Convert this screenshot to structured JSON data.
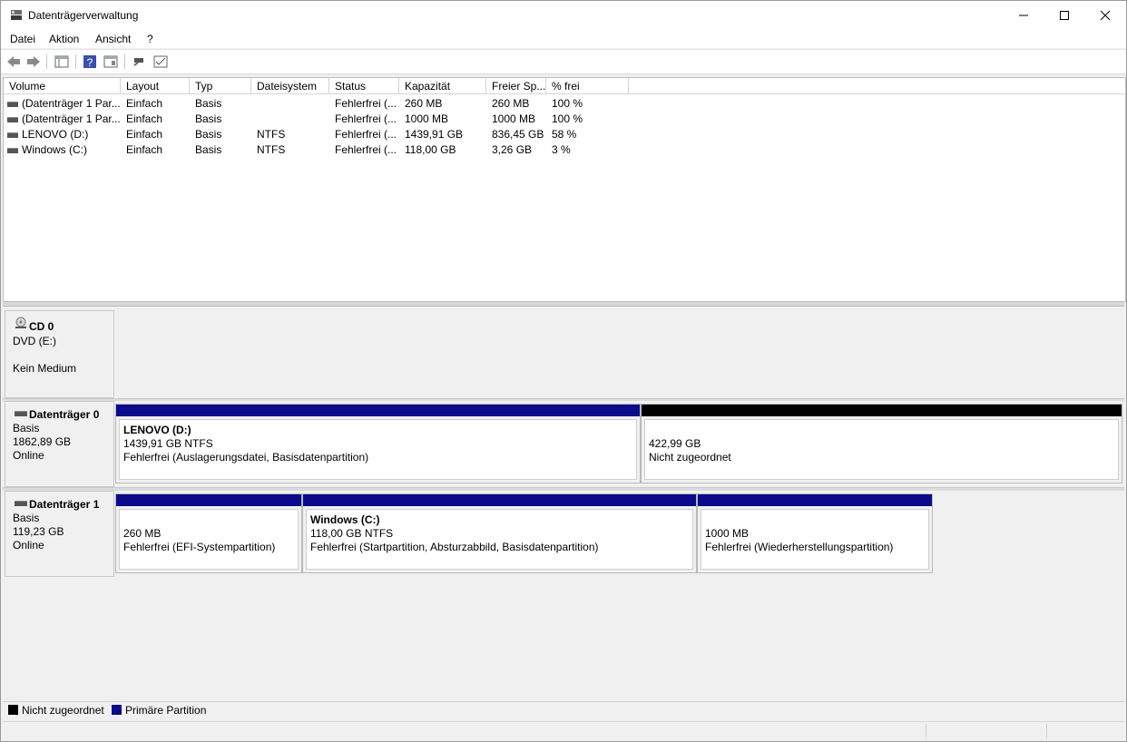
{
  "window": {
    "title": "Datenträgerverwaltung",
    "controls": [
      "minimize-icon",
      "maximize-icon",
      "close-icon"
    ]
  },
  "menu": [
    "Datei",
    "Aktion",
    "Ansicht",
    "?"
  ],
  "toolbar": [
    "back-arrow-icon",
    "forward-arrow-icon",
    "console-tree-icon",
    "help-icon",
    "properties-icon",
    "connect-icon",
    "settings-icon"
  ],
  "volume_table": {
    "columns": [
      "Volume",
      "Layout",
      "Typ",
      "Dateisystem",
      "Status",
      "Kapazität",
      "Freier Sp...",
      "% frei"
    ],
    "rows": [
      [
        "(Datenträger 1 Par...",
        "Einfach",
        "Basis",
        "",
        "Fehlerfrei (...",
        "260 MB",
        "260 MB",
        "100 %"
      ],
      [
        "(Datenträger 1 Par...",
        "Einfach",
        "Basis",
        "",
        "Fehlerfrei (...",
        "1000 MB",
        "1000 MB",
        "100 %"
      ],
      [
        "LENOVO (D:)",
        "Einfach",
        "Basis",
        "NTFS",
        "Fehlerfrei (...",
        "1439,91 GB",
        "836,45 GB",
        "58 %"
      ],
      [
        "Windows (C:)",
        "Einfach",
        "Basis",
        "NTFS",
        "Fehlerfrei (...",
        "118,00 GB",
        "3,26 GB",
        "3 %"
      ]
    ]
  },
  "disks": [
    {
      "name": "CD 0",
      "lines": [
        "DVD (E:)",
        "",
        "Kein Medium"
      ],
      "partitions": []
    },
    {
      "name": "Datenträger 0",
      "lines": [
        "Basis",
        "1862,89 GB",
        "Online"
      ],
      "partitions": [
        {
          "title": "LENOVO  (D:)",
          "size": "1439,91 GB NTFS",
          "status": "Fehlerfrei (Auslagerungsdatei, Basisdatenpartition)",
          "kind": "primary"
        },
        {
          "title": "",
          "size": "422,99 GB",
          "status": "Nicht zugeordnet",
          "kind": "unallocated"
        }
      ]
    },
    {
      "name": "Datenträger 1",
      "lines": [
        "Basis",
        "119,23 GB",
        "Online"
      ],
      "partitions": [
        {
          "title": "",
          "size": "260 MB",
          "status": "Fehlerfrei (EFI-Systempartition)",
          "kind": "primary"
        },
        {
          "title": "Windows  (C:)",
          "size": "118,00 GB NTFS",
          "status": "Fehlerfrei (Startpartition, Absturzabbild, Basisdatenpartition)",
          "kind": "primary"
        },
        {
          "title": "",
          "size": "1000 MB",
          "status": "Fehlerfrei (Wiederherstellungspartition)",
          "kind": "primary"
        }
      ]
    }
  ],
  "legend": [
    {
      "label": "Nicht zugeordnet",
      "color": "#000000"
    },
    {
      "label": "Primäre Partition",
      "color": "#0a0a8a"
    }
  ],
  "colors": {
    "primary": "#0a0a8a",
    "unallocated": "#000000"
  }
}
